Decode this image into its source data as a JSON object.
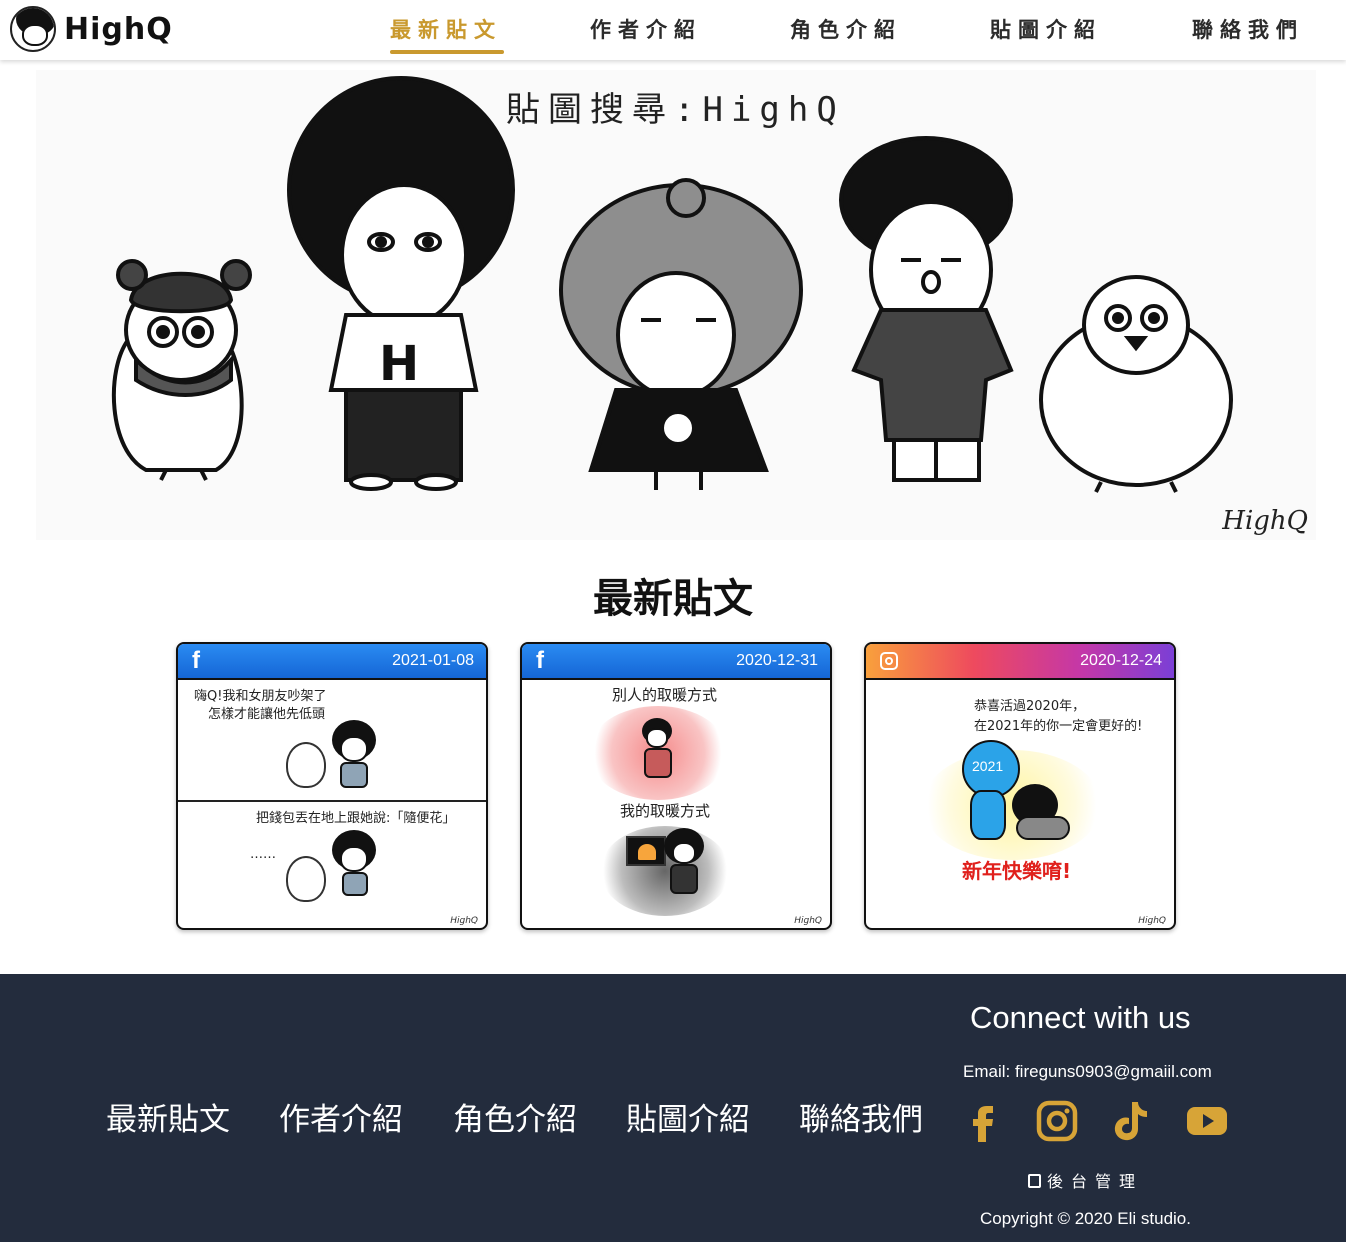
{
  "brand": {
    "name": "HighQ"
  },
  "nav": {
    "items": [
      {
        "label": "最新貼文"
      },
      {
        "label": "作者介紹"
      },
      {
        "label": "角色介紹"
      },
      {
        "label": "貼圖介紹"
      },
      {
        "label": "聯絡我們"
      }
    ],
    "active_index": 0,
    "accent_color": "#c9992e"
  },
  "hero": {
    "title": "貼圖搜尋:HighQ",
    "signature": "HighQ",
    "characters": [
      "bird-with-scarf",
      "afro-boy-H-shirt",
      "curly-girl-Q-dress",
      "boy-gray-shirt",
      "chick"
    ]
  },
  "section": {
    "title": "最新貼文"
  },
  "posts": [
    {
      "platform": "facebook",
      "icon": "facebook-icon",
      "date": "2021-01-08",
      "text1": "嗨Q!我和女朋友吵架了",
      "text2": "怎樣才能讓他先低頭",
      "text3": "把錢包丟在地上跟她說:「隨便花」",
      "text4": "……",
      "signature": "HighQ"
    },
    {
      "platform": "facebook",
      "icon": "facebook-icon",
      "date": "2020-12-31",
      "text1": "別人的取暖方式",
      "text2": "我的取暖方式",
      "signature": "HighQ"
    },
    {
      "platform": "instagram",
      "icon": "instagram-icon",
      "date": "2020-12-24",
      "text1": "恭喜活過2020年，",
      "text2": "在2021年的你一定會更好的!",
      "badge": "2021",
      "text3": "新年快樂唷!",
      "signature": "HighQ"
    }
  ],
  "footer": {
    "nav": [
      "最新貼文",
      "作者介紹",
      "角色介紹",
      "貼圖介紹",
      "聯絡我們"
    ],
    "connect_title": "Connect with us",
    "email": "Email: fireguns0903@gmaiil.com",
    "social_icons": [
      "facebook-icon",
      "instagram-icon",
      "tiktok-icon",
      "youtube-icon"
    ],
    "admin": "後台管理",
    "copyright": "Copyright © 2020 Eli studio.",
    "background": "#232c3d",
    "icon_color": "#d7a437"
  }
}
